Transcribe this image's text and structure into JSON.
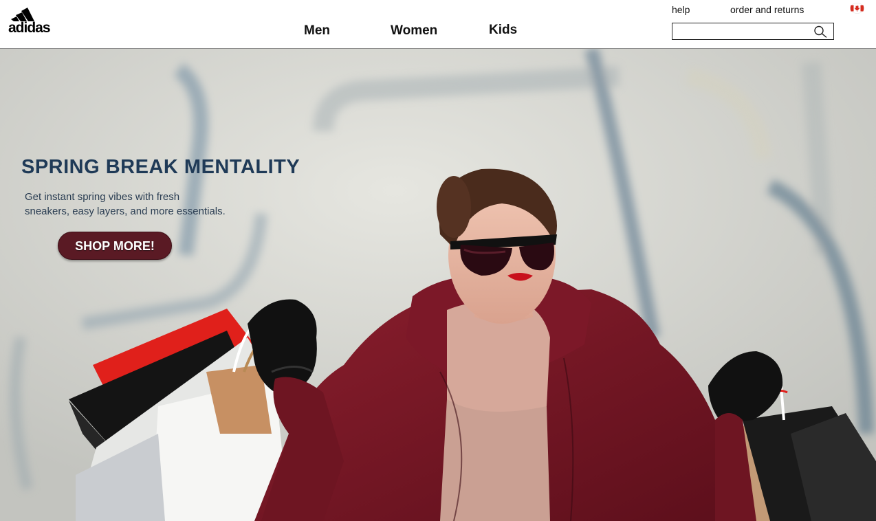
{
  "header": {
    "logo_text": "adidas",
    "nav": [
      {
        "label": "Men"
      },
      {
        "label": "Women"
      },
      {
        "label": "Kids"
      }
    ],
    "top_links": [
      {
        "label": "help"
      },
      {
        "label": "order and returns"
      }
    ],
    "search": {
      "value": "",
      "placeholder": ""
    },
    "flag_icon": "canada-flag-icon"
  },
  "hero": {
    "title": "SPRING BREAK MENTALITY",
    "subtitle_lines": [
      "Get instant spring vibes with fresh",
      "sneakers, easy layers, and more essentials."
    ],
    "cta_label": "SHOP MORE!",
    "image": "woman-with-shopping-bags-photo"
  },
  "colors": {
    "title": "#1f3a57",
    "cta_background": "#5a1a24",
    "coat": "#7a1726"
  }
}
